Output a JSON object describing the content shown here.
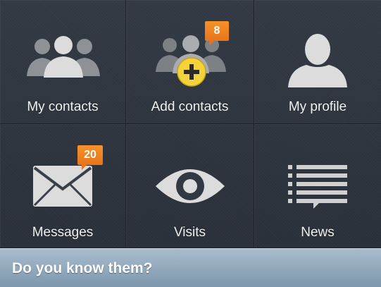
{
  "tiles": [
    {
      "label": "My contacts",
      "icon": "contacts-icon"
    },
    {
      "label": "Add contacts",
      "icon": "add-contacts-icon",
      "badge": "8"
    },
    {
      "label": "My profile",
      "icon": "profile-icon"
    },
    {
      "label": "Messages",
      "icon": "envelope-icon",
      "badge": "20"
    },
    {
      "label": "Visits",
      "icon": "eye-icon"
    },
    {
      "label": "News",
      "icon": "news-list-icon"
    }
  ],
  "footer": {
    "title": "Do you know them?"
  },
  "colors": {
    "badge": "#f08020",
    "icon": "#d9d9d9",
    "footer": "#93a9bd",
    "plus_circle": "#f3d23a"
  }
}
